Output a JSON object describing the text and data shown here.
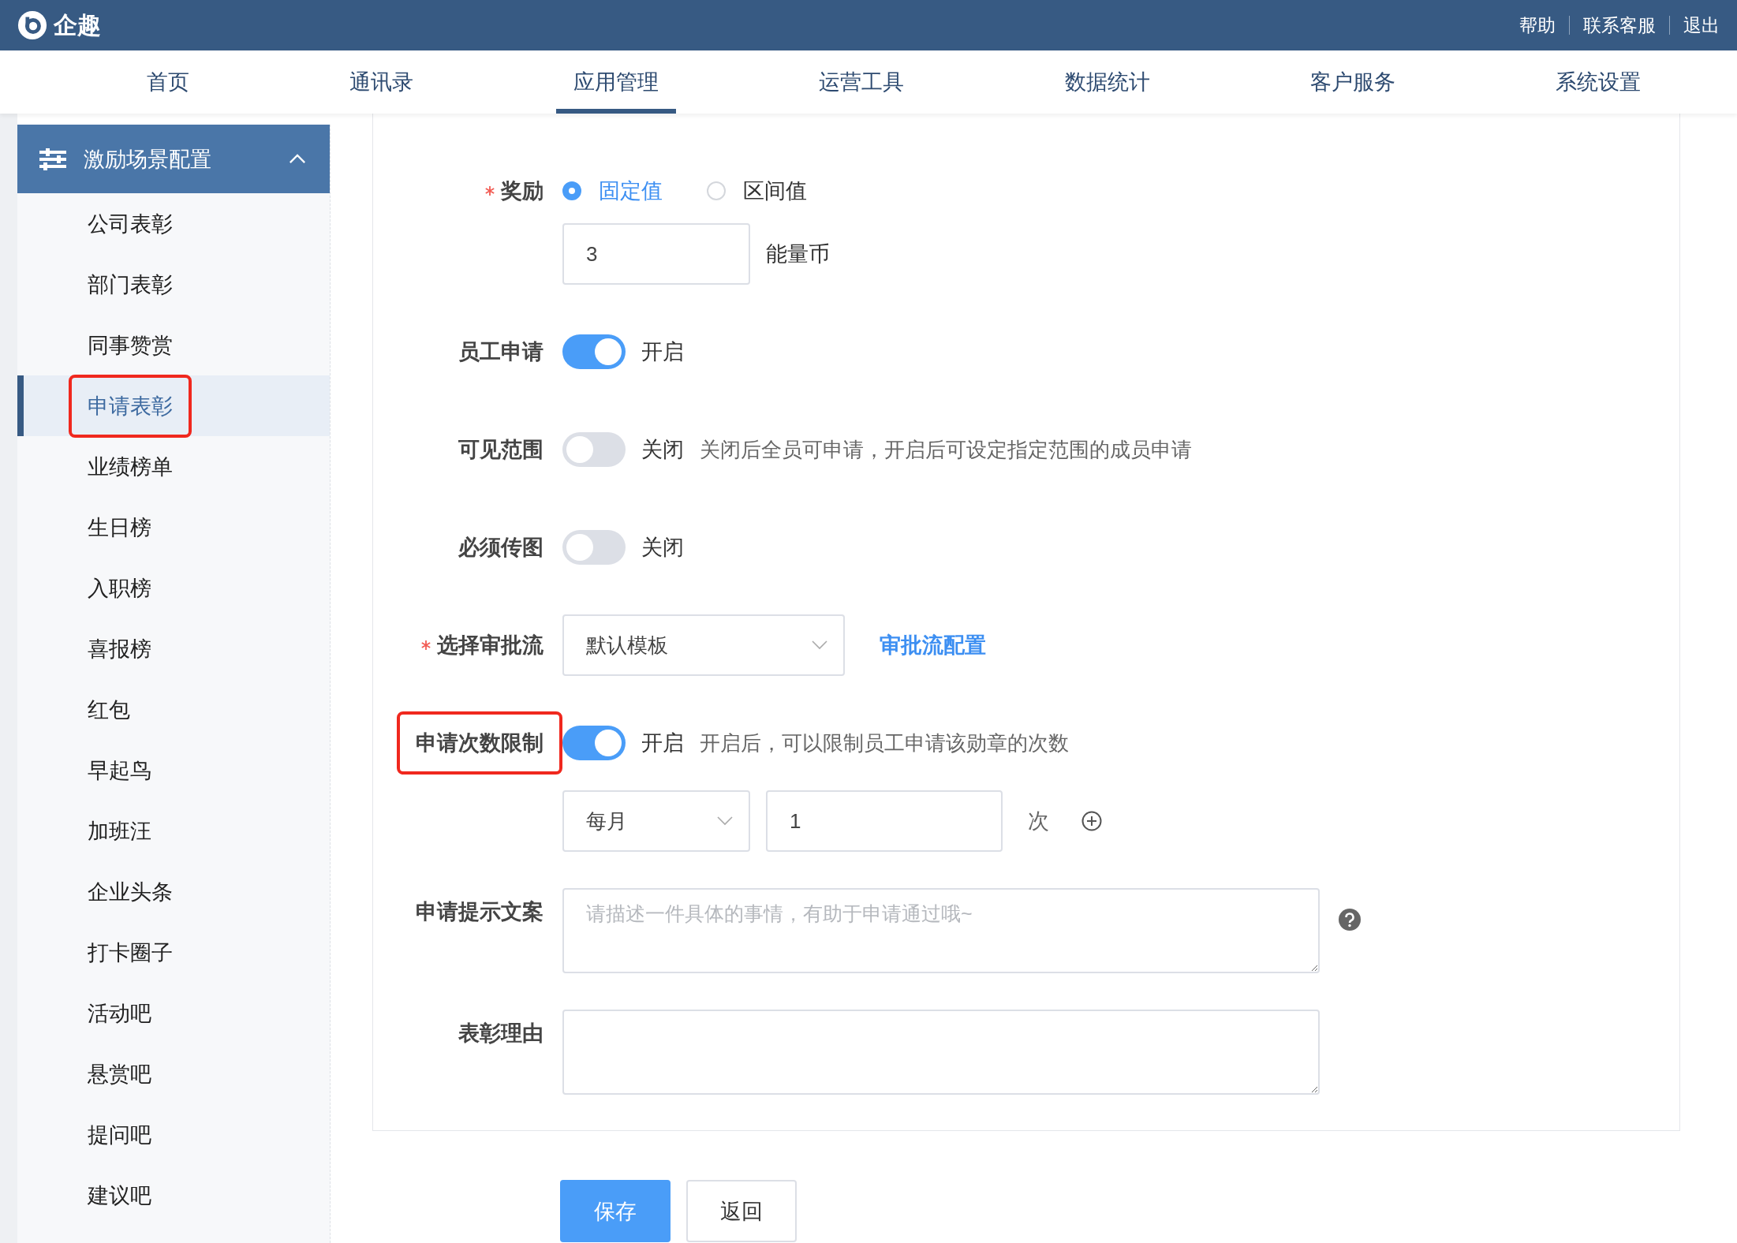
{
  "app": {
    "name": "企趣"
  },
  "top_links": [
    "帮助",
    "联系客服",
    "退出"
  ],
  "nav_tabs": [
    {
      "label": "首页",
      "selected": false
    },
    {
      "label": "通讯录",
      "selected": false
    },
    {
      "label": "应用管理",
      "selected": true
    },
    {
      "label": "运营工具",
      "selected": false
    },
    {
      "label": "数据统计",
      "selected": false
    },
    {
      "label": "客户服务",
      "selected": false
    },
    {
      "label": "系统设置",
      "selected": false
    }
  ],
  "sidebar": {
    "group": {
      "title": "激励场景配置",
      "expanded": true
    },
    "items": [
      {
        "label": "公司表彰",
        "selected": false,
        "highlighted": false
      },
      {
        "label": "部门表彰",
        "selected": false,
        "highlighted": false
      },
      {
        "label": "同事赞赏",
        "selected": false,
        "highlighted": false
      },
      {
        "label": "申请表彰",
        "selected": true,
        "highlighted": true
      },
      {
        "label": "业绩榜单",
        "selected": false,
        "highlighted": false
      },
      {
        "label": "生日榜",
        "selected": false,
        "highlighted": false
      },
      {
        "label": "入职榜",
        "selected": false,
        "highlighted": false
      },
      {
        "label": "喜报榜",
        "selected": false,
        "highlighted": false
      },
      {
        "label": "红包",
        "selected": false,
        "highlighted": false
      },
      {
        "label": "早起鸟",
        "selected": false,
        "highlighted": false
      },
      {
        "label": "加班汪",
        "selected": false,
        "highlighted": false
      },
      {
        "label": "企业头条",
        "selected": false,
        "highlighted": false
      },
      {
        "label": "打卡圈子",
        "selected": false,
        "highlighted": false
      },
      {
        "label": "活动吧",
        "selected": false,
        "highlighted": false
      },
      {
        "label": "悬赏吧",
        "selected": false,
        "highlighted": false
      },
      {
        "label": "提问吧",
        "selected": false,
        "highlighted": false
      },
      {
        "label": "建议吧",
        "selected": false,
        "highlighted": false
      }
    ]
  },
  "form": {
    "fields": [
      {
        "kind": "radio",
        "label": "奖励",
        "required": true,
        "highlighted": false,
        "options": [
          {
            "label": "固定值",
            "selected": true
          },
          {
            "label": "区间值",
            "selected": false
          }
        ],
        "value": "3",
        "unit": "能量币"
      },
      {
        "kind": "toggle",
        "label": "员工申请",
        "required": false,
        "highlighted": false,
        "on": true,
        "state_text": "开启"
      },
      {
        "kind": "toggle",
        "label": "可见范围",
        "required": false,
        "highlighted": false,
        "on": false,
        "state_text": "关闭",
        "hint": "关闭后全员可申请，开启后可设定指定范围的成员申请"
      },
      {
        "kind": "toggle",
        "label": "必须传图",
        "required": false,
        "highlighted": false,
        "on": false,
        "state_text": "关闭"
      },
      {
        "kind": "select",
        "label": "选择审批流",
        "required": true,
        "highlighted": false,
        "value": "默认模板",
        "link": "审批流配置"
      },
      {
        "kind": "toggle",
        "label": "申请次数限制",
        "required": false,
        "highlighted": true,
        "on": true,
        "state_text": "开启",
        "hint": "开启后，可以限制员工申请该勋章的次数",
        "limit": {
          "period": "每月",
          "value": "1",
          "unit": "次"
        }
      },
      {
        "kind": "textarea",
        "label": "申请提示文案",
        "required": false,
        "highlighted": false,
        "placeholder": "请描述一件具体的事情，有助于申请通过哦~",
        "help": true
      },
      {
        "kind": "textarea",
        "label": "表彰理由",
        "required": false,
        "highlighted": false,
        "help": false
      }
    ]
  },
  "buttons": [
    {
      "label": "保存",
      "kind": "primary"
    },
    {
      "label": "返回",
      "kind": "default"
    }
  ]
}
